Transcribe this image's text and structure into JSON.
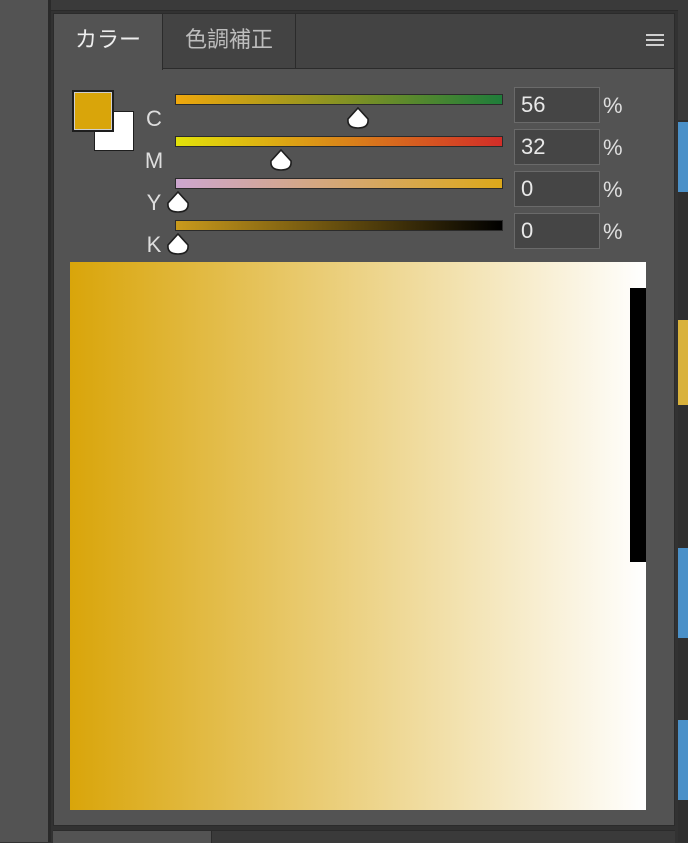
{
  "tabs": [
    {
      "label": "カラー",
      "active": true
    },
    {
      "label": "色調補正",
      "active": false
    }
  ],
  "menu_icon": "hamburger-menu-icon",
  "foreground_color": "#D9A50A",
  "background_color": "#FFFFFF",
  "channels": [
    {
      "label": "C",
      "value": "56",
      "fraction": 0.56,
      "unit": "%",
      "gradient": [
        "#F0A80C",
        "#1F7D3A"
      ]
    },
    {
      "label": "M",
      "value": "32",
      "fraction": 0.32,
      "unit": "%",
      "gradient": [
        "#E2E20A",
        "#D22D28"
      ]
    },
    {
      "label": "Y",
      "value": "0",
      "fraction": 0.0,
      "unit": "%",
      "gradient": [
        "#CDA6CF",
        "#DCA81A"
      ]
    },
    {
      "label": "K",
      "value": "0",
      "fraction": 0.0,
      "unit": "%",
      "gradient": [
        "#C99A1C",
        "#000000"
      ]
    }
  ],
  "ramp": {
    "from": "#D9A50A",
    "to": "#FFFFFF",
    "black_bar": "#000000"
  }
}
